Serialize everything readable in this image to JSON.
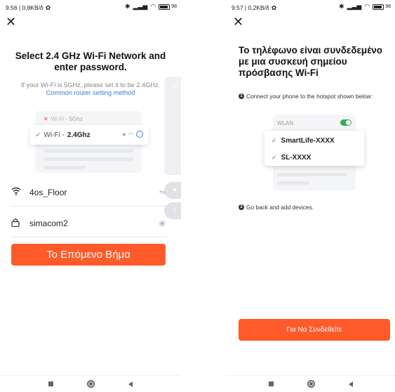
{
  "left": {
    "status": {
      "time": "9:56 | 0,8KB/δ",
      "battery": "98"
    },
    "title": "Select 2.4 GHz Wi-Fi Network and enter password.",
    "hint": "If your Wi-Fi is 5GHz, please set it to be 2.4GHz.",
    "link": "Common router setting method",
    "illustration": {
      "bad_prefix": "Wi-Fi - ",
      "bad_band": "5Ghz",
      "good_prefix": "Wi-Fi - ",
      "good_band": "2.4Ghz"
    },
    "wifi_name": "4os_Floor",
    "password": "simacom2",
    "next_button": "Το Επόμενο Βήμα"
  },
  "right": {
    "status": {
      "time": "9:57 | 0,2KB/δ",
      "battery": "98"
    },
    "title": "Το τηλέφωνο είναι συνδεδεμένο με μια συσκευή σημείου πρόσβασης Wi-Fi",
    "step1": "Connect your phone to the hotspot shown below:",
    "step2": "Go back and add devices.",
    "step1_num": "1",
    "step2_num": "2",
    "wlan_label": "WLAN",
    "hotspots": [
      "SmartLife-XXXX",
      "SL-XXXX"
    ],
    "connect_button": "Για Να Συνδεθείτε"
  },
  "colors": {
    "accent": "#ff5a2a",
    "link": "#3a7bd5",
    "toggle_on": "#3aaa57"
  },
  "icons": [
    "close-icon",
    "wifi-icon",
    "lock-icon",
    "eye-icon",
    "swap-icon",
    "bluetooth-icon",
    "signal-icon",
    "battery-icon",
    "gear-icon"
  ]
}
